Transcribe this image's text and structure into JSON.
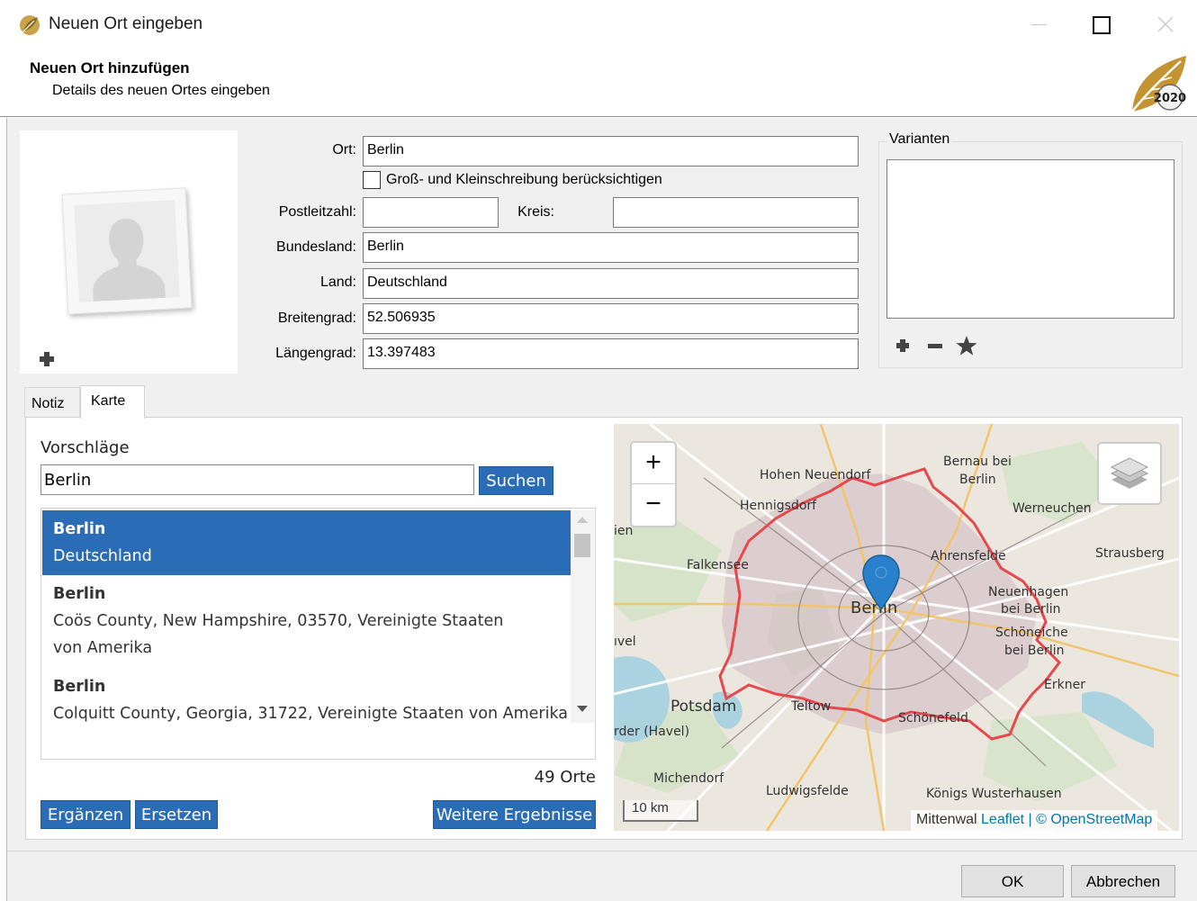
{
  "window": {
    "title": "Neuen Ort eingeben"
  },
  "header": {
    "title": "Neuen Ort hinzufügen",
    "subtitle": "Details des neuen Ortes eingeben",
    "logo_text": "2020"
  },
  "form": {
    "ort_label": "Ort:",
    "ort_value": "Berlin",
    "case_checkbox_label": "Groß- und Kleinschreibung berücksichtigen",
    "case_checked": false,
    "postleitzahl_label": "Postleitzahl:",
    "postleitzahl_value": "",
    "kreis_label": "Kreis:",
    "kreis_value": "",
    "bundesland_label": "Bundesland:",
    "bundesland_value": "Berlin",
    "land_label": "Land:",
    "land_value": "Deutschland",
    "breitengrad_label": "Breitengrad:",
    "breitengrad_value": "52.506935",
    "laengengrad_label": "Längengrad:",
    "laengengrad_value": "13.397483"
  },
  "variants": {
    "legend": "Varianten",
    "items": []
  },
  "tabs": [
    {
      "label": "Notiz",
      "active": false
    },
    {
      "label": "Karte",
      "active": true
    }
  ],
  "suggestions": {
    "label": "Vorschläge",
    "search_value": "Berlin",
    "search_button": "Suchen",
    "results": [
      {
        "name": "Berlin",
        "detail": "Deutschland",
        "selected": true
      },
      {
        "name": "Berlin",
        "detail": "Coös County, New Hampshire, 03570, Vereinigte Staaten von Amerika",
        "selected": false
      },
      {
        "name": "Berlin",
        "detail": "Colquitt County, Georgia, 31722, Vereinigte Staaten von Amerika",
        "selected": false
      }
    ],
    "count_text": "49 Orte",
    "ergaenzen_button": "Ergänzen",
    "ersetzen_button": "Ersetzen",
    "more_button": "Weitere Ergebnisse"
  },
  "map": {
    "zoom_in": "+",
    "zoom_out": "−",
    "scale_text": "10 km",
    "attribution_prefix": "Mittenwal",
    "attribution_leaflet": "Leaflet",
    "attribution_sep": " | © ",
    "attribution_osm": "OpenStreetMap",
    "places": {
      "bernau": "Bernau bei",
      "bernau2": "Berlin",
      "hohen_neuendorf": "Hohen Neuendorf",
      "hennigsdorf": "Hennigsdorf",
      "werneuchen": "Werneuchen",
      "strausberg": "Strausberg",
      "ahrensfelde": "Ahrensfelde",
      "falkensee": "Falkensee",
      "neuenhagen": "Neuenhagen",
      "neuenhagen2": "bei Berlin",
      "berlin": "Berlin",
      "schoeneiche": "Schöneiche",
      "schoeneiche2": "bei Berlin",
      "erkner": "Erkner",
      "potsdam": "Potsdam",
      "teltow": "Teltow",
      "schoenefeld": "Schönefeld",
      "werder": "rder (Havel)",
      "michendorf": "Michendorf",
      "ludwigsfelde": "Ludwigsfelde",
      "koenigs": "Königs Wusterhausen",
      "ien": "ien",
      "vel": "ıvel"
    },
    "colors": {
      "boundary": "#e8474b",
      "marker": "#2a81cb",
      "urban": "#d9c8cc"
    }
  },
  "footer": {
    "ok": "OK",
    "cancel": "Abbrechen"
  }
}
